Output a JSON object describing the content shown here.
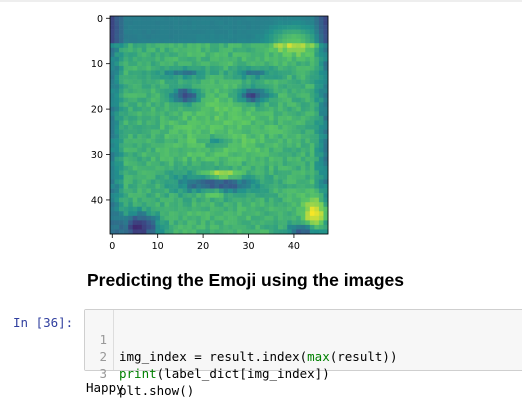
{
  "plot": {
    "x_ticks": [
      "0",
      "10",
      "20",
      "30",
      "40"
    ],
    "y_ticks": [
      "0",
      "10",
      "20",
      "30",
      "40"
    ],
    "palette": [
      "#440154",
      "#3b528b",
      "#21918c",
      "#5ec962",
      "#fde725"
    ]
  },
  "markdown": {
    "heading": "Predicting the Emoji using the images"
  },
  "cell": {
    "prompt": "In [36]:",
    "lines": [
      {
        "num": "1",
        "a": "img_index = result.index(",
        "b": "max",
        "c": "(result))"
      },
      {
        "num": "2",
        "a": "",
        "b": "print",
        "c": "(label_dict[img_index])"
      },
      {
        "num": "3",
        "a": "plt.show()",
        "b": "",
        "c": ""
      }
    ]
  },
  "output": {
    "text": "Happy"
  }
}
